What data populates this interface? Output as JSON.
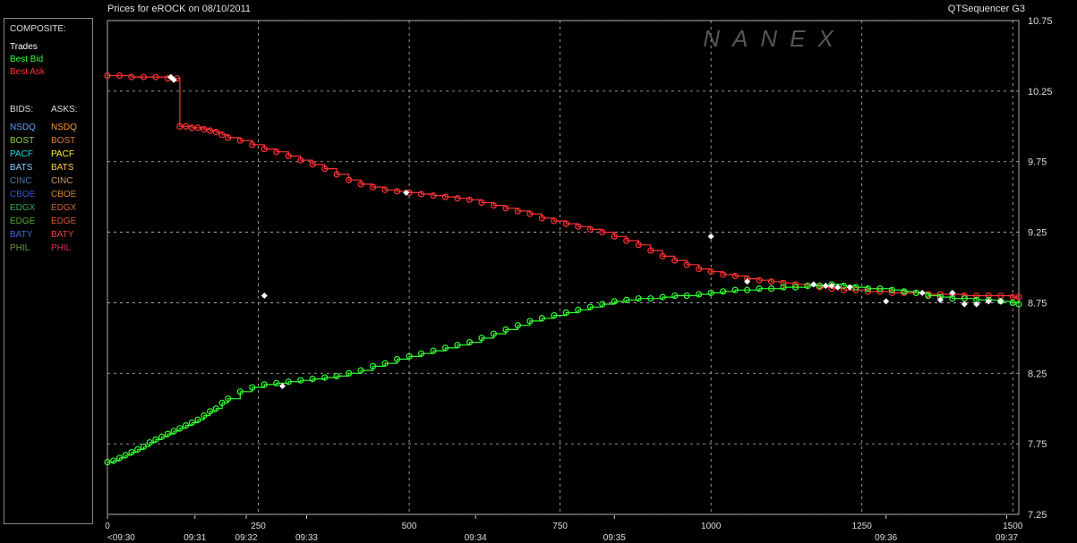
{
  "header": {
    "title": "Prices for  eROCK  on  08/10/2011",
    "engine": "QTSequencer G3",
    "watermark": "NANEX"
  },
  "legend": {
    "composite_label": "COMPOSITE:",
    "composite": [
      {
        "label": "Trades",
        "color": "#ffffff"
      },
      {
        "label": "Best Bid",
        "color": "#33ff33"
      },
      {
        "label": "Best Ask",
        "color": "#ff3333"
      }
    ],
    "bids_label": "BIDS:",
    "asks_label": "ASKS:",
    "bids": [
      {
        "label": "NSDQ",
        "color": "#5aa0ff"
      },
      {
        "label": "BOST",
        "color": "#88cc55"
      },
      {
        "label": "PACF",
        "color": "#22dddd"
      },
      {
        "label": "BATS",
        "color": "#88ccff"
      },
      {
        "label": "CINC",
        "color": "#4477aa"
      },
      {
        "label": "CBOE",
        "color": "#3355cc"
      },
      {
        "label": "EDGX",
        "color": "#33aa55"
      },
      {
        "label": "EDGE",
        "color": "#55aa33"
      },
      {
        "label": "BATY",
        "color": "#4466dd"
      },
      {
        "label": "PHIL",
        "color": "#669933"
      }
    ],
    "asks": [
      {
        "label": "NSDQ",
        "color": "#ff9933"
      },
      {
        "label": "BOST",
        "color": "#dd7744"
      },
      {
        "label": "PACF",
        "color": "#ffee44"
      },
      {
        "label": "BATS",
        "color": "#ffcc44"
      },
      {
        "label": "CINC",
        "color": "#cc9966"
      },
      {
        "label": "CBOE",
        "color": "#cc8833"
      },
      {
        "label": "EDGX",
        "color": "#cc6633"
      },
      {
        "label": "EDGE",
        "color": "#dd5533"
      },
      {
        "label": "BATY",
        "color": "#ee4444"
      },
      {
        "label": "PHIL",
        "color": "#cc3355"
      }
    ]
  },
  "chart_data": {
    "type": "line",
    "title": "Prices for  eROCK  on  08/10/2011",
    "xlim": [
      0,
      1510
    ],
    "ylim": [
      7.25,
      10.75
    ],
    "x_ticks": [
      0,
      250,
      500,
      750,
      1000,
      1250,
      1500
    ],
    "y_ticks": [
      7.25,
      7.75,
      8.25,
      8.75,
      9.25,
      9.75,
      10.25,
      10.75
    ],
    "y_tick_labels": [
      "7.25",
      "7.75",
      "8.25",
      "8.75",
      "9.25",
      "9.75",
      "10.25",
      "10.75"
    ],
    "time_ticks": [
      {
        "x": 0,
        "label": "<09:30"
      },
      {
        "x": 145,
        "label": "09:31"
      },
      {
        "x": 230,
        "label": "09:32"
      },
      {
        "x": 330,
        "label": "09:33"
      },
      {
        "x": 610,
        "label": "09:34"
      },
      {
        "x": 840,
        "label": "09:35"
      },
      {
        "x": 1290,
        "label": "09:36"
      },
      {
        "x": 1490,
        "label": "09:37"
      }
    ],
    "grid": true,
    "series": [
      {
        "name": "Best Ask",
        "color": "#ff3333",
        "x": [
          0,
          20,
          40,
          60,
          80,
          100,
          115,
          120,
          130,
          140,
          150,
          160,
          170,
          180,
          190,
          200,
          220,
          240,
          260,
          280,
          300,
          320,
          340,
          360,
          380,
          400,
          420,
          440,
          460,
          480,
          500,
          520,
          540,
          560,
          580,
          600,
          620,
          640,
          660,
          680,
          700,
          720,
          740,
          760,
          780,
          800,
          820,
          840,
          860,
          880,
          900,
          920,
          940,
          960,
          980,
          1000,
          1020,
          1040,
          1060,
          1080,
          1100,
          1120,
          1140,
          1160,
          1180,
          1200,
          1220,
          1240,
          1260,
          1280,
          1300,
          1320,
          1340,
          1360,
          1380,
          1400,
          1420,
          1440,
          1460,
          1480,
          1500,
          1510
        ],
        "values": [
          10.36,
          10.36,
          10.35,
          10.35,
          10.35,
          10.34,
          10.34,
          10.0,
          10.0,
          9.99,
          9.99,
          9.98,
          9.97,
          9.96,
          9.94,
          9.92,
          9.9,
          9.87,
          9.84,
          9.82,
          9.79,
          9.76,
          9.73,
          9.7,
          9.66,
          9.62,
          9.59,
          9.57,
          9.55,
          9.54,
          9.53,
          9.52,
          9.51,
          9.5,
          9.49,
          9.48,
          9.46,
          9.44,
          9.42,
          9.4,
          9.38,
          9.35,
          9.33,
          9.31,
          9.29,
          9.27,
          9.25,
          9.22,
          9.19,
          9.16,
          9.12,
          9.08,
          9.05,
          9.02,
          8.99,
          8.97,
          8.95,
          8.94,
          8.92,
          8.91,
          8.9,
          8.89,
          8.88,
          8.87,
          8.86,
          8.85,
          8.84,
          8.84,
          8.83,
          8.83,
          8.82,
          8.82,
          8.82,
          8.81,
          8.81,
          8.81,
          8.8,
          8.8,
          8.8,
          8.8,
          8.79,
          8.79
        ]
      },
      {
        "name": "Best Bid",
        "color": "#33ff33",
        "x": [
          0,
          10,
          20,
          30,
          40,
          50,
          60,
          70,
          80,
          90,
          100,
          110,
          120,
          130,
          140,
          150,
          160,
          170,
          180,
          190,
          200,
          220,
          240,
          260,
          280,
          300,
          320,
          340,
          360,
          380,
          400,
          420,
          440,
          460,
          480,
          500,
          520,
          540,
          560,
          580,
          600,
          620,
          640,
          660,
          680,
          700,
          720,
          740,
          760,
          780,
          800,
          820,
          840,
          860,
          880,
          900,
          920,
          940,
          960,
          980,
          1000,
          1020,
          1040,
          1060,
          1080,
          1100,
          1120,
          1140,
          1160,
          1180,
          1200,
          1220,
          1240,
          1260,
          1280,
          1300,
          1320,
          1340,
          1360,
          1380,
          1400,
          1420,
          1440,
          1460,
          1480,
          1500,
          1510
        ],
        "values": [
          7.62,
          7.63,
          7.65,
          7.67,
          7.69,
          7.71,
          7.73,
          7.76,
          7.78,
          7.8,
          7.82,
          7.84,
          7.86,
          7.88,
          7.9,
          7.92,
          7.95,
          7.98,
          8.0,
          8.04,
          8.07,
          8.12,
          8.15,
          8.17,
          8.18,
          8.19,
          8.2,
          8.21,
          8.22,
          8.23,
          8.25,
          8.27,
          8.3,
          8.32,
          8.35,
          8.37,
          8.39,
          8.41,
          8.43,
          8.45,
          8.47,
          8.5,
          8.53,
          8.56,
          8.59,
          8.62,
          8.64,
          8.66,
          8.68,
          8.7,
          8.72,
          8.74,
          8.76,
          8.77,
          8.78,
          8.78,
          8.79,
          8.8,
          8.8,
          8.81,
          8.82,
          8.83,
          8.84,
          8.84,
          8.85,
          8.85,
          8.86,
          8.86,
          8.87,
          8.87,
          8.88,
          8.87,
          8.86,
          8.85,
          8.85,
          8.84,
          8.83,
          8.82,
          8.8,
          8.79,
          8.78,
          8.78,
          8.77,
          8.77,
          8.76,
          8.75,
          8.74
        ]
      },
      {
        "name": "Trades",
        "color": "#ffffff",
        "x": [
          105,
          110,
          260,
          290,
          495,
          1000,
          1060,
          1170,
          1190,
          1200,
          1210,
          1230,
          1290,
          1350,
          1380,
          1400,
          1420,
          1440,
          1460,
          1480
        ],
        "values": [
          10.35,
          10.33,
          8.8,
          8.16,
          9.53,
          9.22,
          8.9,
          8.88,
          8.87,
          8.87,
          8.86,
          8.86,
          8.76,
          8.82,
          8.77,
          8.82,
          8.74,
          8.74,
          8.76,
          8.76
        ]
      }
    ]
  }
}
